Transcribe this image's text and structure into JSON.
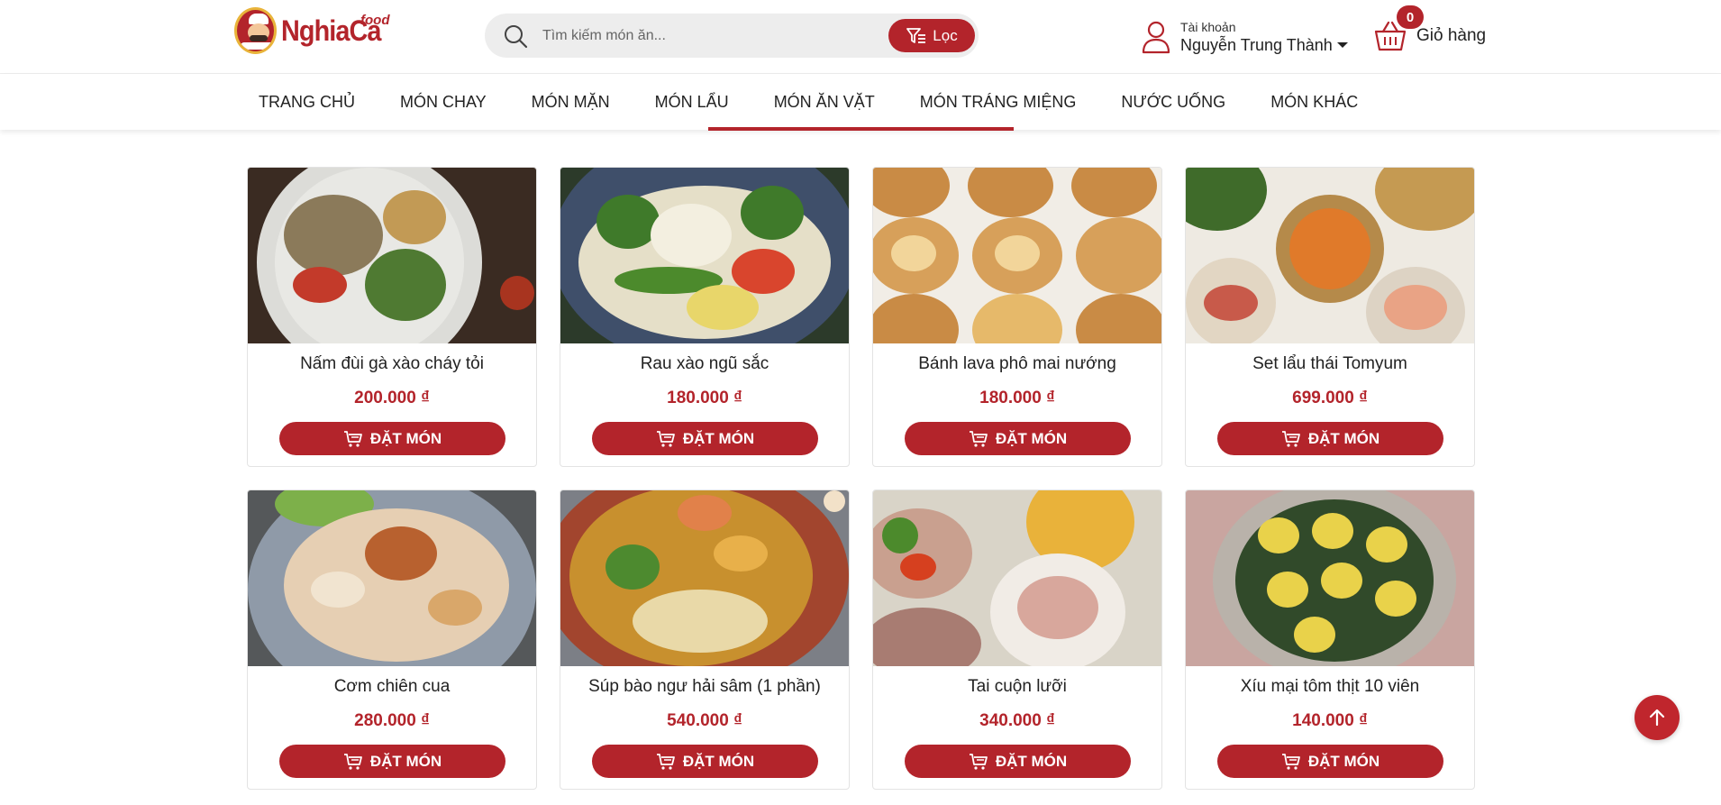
{
  "brand": {
    "name": "NghiaCa",
    "tag": "food",
    "color": "#b3242b"
  },
  "search": {
    "placeholder": "Tìm kiếm món ăn...",
    "filter_label": "Lọc"
  },
  "account": {
    "caption": "Tài khoản",
    "user_name": "Nguyễn Trung Thành"
  },
  "cart": {
    "count": "0",
    "label": "Giỏ hàng"
  },
  "nav": {
    "items": [
      {
        "label": "TRANG CHỦ"
      },
      {
        "label": "MÓN CHAY"
      },
      {
        "label": "MÓN MẶN"
      },
      {
        "label": "MÓN LẨU"
      },
      {
        "label": "MÓN ĂN VẶT"
      },
      {
        "label": "MÓN TRÁNG MIỆNG"
      },
      {
        "label": "NƯỚC UỐNG"
      },
      {
        "label": "MÓN KHÁC"
      }
    ]
  },
  "products": [
    {
      "name": "Nấm đùi gà xào cháy tỏi",
      "price": "200.000 ₫",
      "order_label": "ĐẶT MÓN"
    },
    {
      "name": "Rau xào ngũ sắc",
      "price": "180.000 ₫",
      "order_label": "ĐẶT MÓN"
    },
    {
      "name": "Bánh lava phô mai nướng",
      "price": "180.000 ₫",
      "order_label": "ĐẶT MÓN"
    },
    {
      "name": "Set lẩu thái Tomyum",
      "price": "699.000 ₫",
      "order_label": "ĐẶT MÓN"
    },
    {
      "name": "Cơm chiên cua",
      "price": "280.000 ₫",
      "order_label": "ĐẶT MÓN"
    },
    {
      "name": "Súp bào ngư hải sâm (1 phần)",
      "price": "540.000 ₫",
      "order_label": "ĐẶT MÓN"
    },
    {
      "name": "Tai cuộn lưỡi",
      "price": "340.000 ₫",
      "order_label": "ĐẶT MÓN"
    },
    {
      "name": "Xíu mại tôm thịt 10 viên",
      "price": "140.000 ₫",
      "order_label": "ĐẶT MÓN"
    }
  ],
  "icons": {
    "search": "search-icon",
    "filter": "filter-icon",
    "user": "user-icon",
    "cart": "basket-icon",
    "order": "cart-icon",
    "to_top": "arrow-up-icon"
  }
}
